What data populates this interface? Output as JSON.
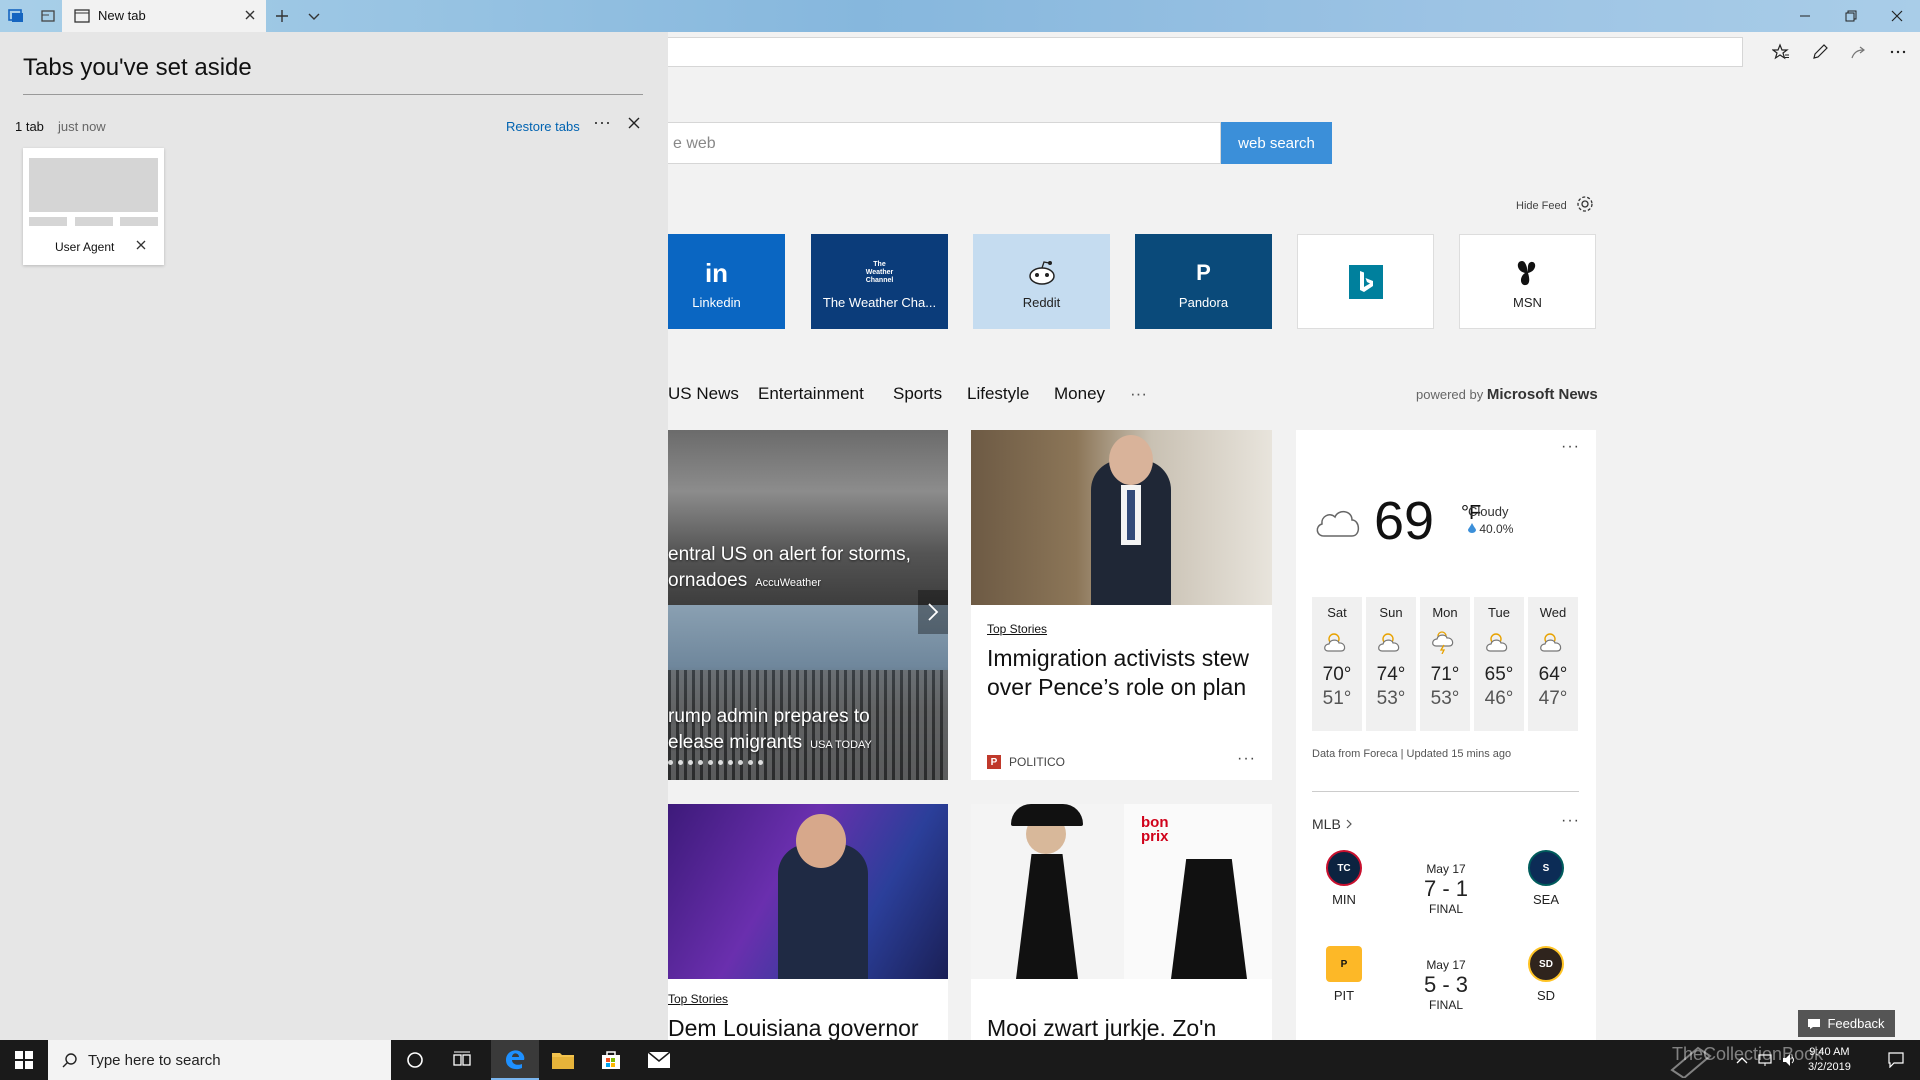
{
  "browser": {
    "tab_title": "New tab",
    "search_placeholder": "e web",
    "search_button": "web search",
    "hide_feed": "Hide Feed"
  },
  "colors": {
    "accent": "#3b8fd9",
    "link": "#0063b1"
  },
  "tiles": [
    {
      "label": "Linkedin",
      "logo": "in",
      "bg": "#0a66c2"
    },
    {
      "label": "The Weather Cha...",
      "logo": "The Weather Channel",
      "bg": "#0b3c7a"
    },
    {
      "label": "Reddit",
      "logo": "reddit-icon",
      "bg": "#c5dcf0"
    },
    {
      "label": "Pandora",
      "logo": "P",
      "bg": "#0a4a7a"
    },
    {
      "label": "",
      "logo": "bing-icon",
      "bg": "#ffffff"
    },
    {
      "label": "MSN",
      "logo": "msn-icon",
      "bg": "#ffffff"
    }
  ],
  "categories": [
    "US News",
    "Entertainment",
    "Sports",
    "Lifestyle",
    "Money"
  ],
  "categories_more": "···",
  "powered_by": {
    "prefix": "powered by",
    "brand": "Microsoft News"
  },
  "hero": {
    "slides": [
      {
        "title_line1": "entral US on alert for storms,",
        "title_line2": "ornadoes",
        "source": "AccuWeather"
      },
      {
        "title_line1": "rump admin prepares to",
        "title_line2": "elease migrants",
        "source": "USA TODAY"
      }
    ]
  },
  "story1": {
    "category": "Top Stories",
    "title": "Immigration activists stew over Pence’s role on plan",
    "source": "POLITICO",
    "source_logo": "P",
    "more": "···"
  },
  "weather": {
    "temp": "69",
    "unit": "°F",
    "condition": "Cloudy",
    "precip": "40.0%",
    "more": "···",
    "days": [
      {
        "name": "Sat",
        "hi": "70°",
        "lo": "51°"
      },
      {
        "name": "Sun",
        "hi": "74°",
        "lo": "53°"
      },
      {
        "name": "Mon",
        "hi": "71°",
        "lo": "53°"
      },
      {
        "name": "Tue",
        "hi": "65°",
        "lo": "46°"
      },
      {
        "name": "Wed",
        "hi": "64°",
        "lo": "47°"
      }
    ],
    "footer": "Data from Foreca | Updated 15 mins ago"
  },
  "mlb": {
    "label": "MLB",
    "more": "···",
    "games": [
      {
        "date": "May 17",
        "score": "7 - 1",
        "status": "FINAL",
        "home": "MIN",
        "away": "SEA"
      },
      {
        "date": "May 17",
        "score": "5 - 3",
        "status": "FINAL",
        "home": "PIT",
        "away": "SD"
      }
    ]
  },
  "story3": {
    "category": "Top Stories",
    "title": "Dem Louisiana governor"
  },
  "story4": {
    "title": "Mooi zwart jurkje. Zo'n",
    "brand_line1": "bon",
    "brand_line2": "prix"
  },
  "aside": {
    "title": "Tabs you've set aside",
    "count": "1 tab",
    "time": "just now",
    "restore": "Restore tabs",
    "more": "···",
    "thumbnail_label": "User Agent"
  },
  "feedback": "Feedback",
  "taskbar": {
    "search_placeholder": "Type here to search",
    "time": "9:40 AM",
    "date": "3/2/2019",
    "watermark": "TheCollectionBook"
  }
}
